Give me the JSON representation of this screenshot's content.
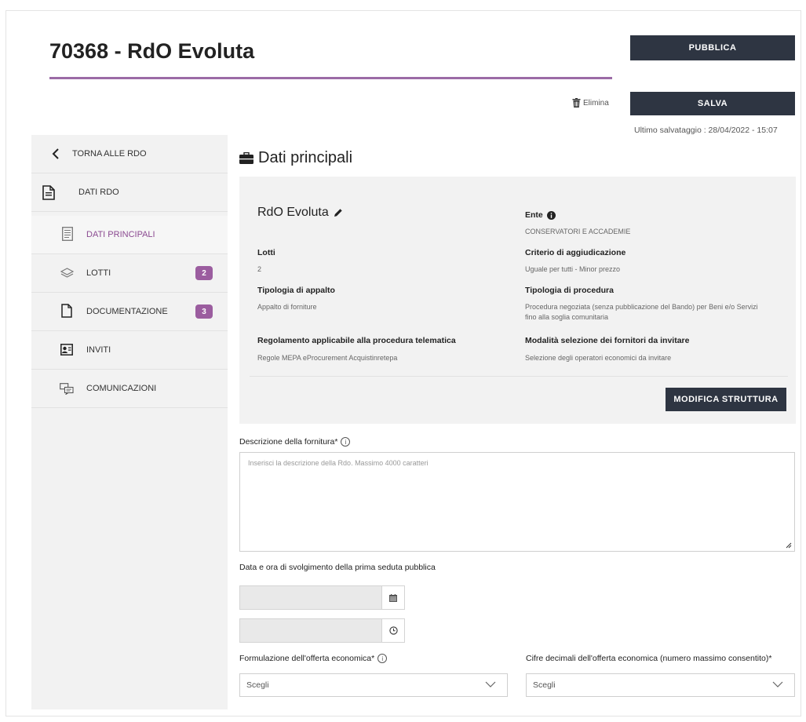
{
  "header": {
    "title": "70368 - RdO Evoluta",
    "publish_label": "PUBBLICA",
    "save_label": "SALVA",
    "delete_label": "Elimina",
    "last_save": "Ultimo salvataggio : 28/04/2022 - 15:07"
  },
  "sidebar": {
    "back_label": "TORNA ALLE RDO",
    "group_label": "DATI RDO",
    "items": [
      {
        "label": "DATI PRINCIPALI",
        "icon": "document-list-icon",
        "active": true
      },
      {
        "label": "LOTTI",
        "icon": "layers-icon",
        "badge": "2"
      },
      {
        "label": "DOCUMENTAZIONE",
        "icon": "file-icon",
        "badge": "3"
      },
      {
        "label": "INVITI",
        "icon": "contact-card-icon"
      },
      {
        "label": "COMUNICAZIONI",
        "icon": "chat-icon"
      }
    ]
  },
  "main": {
    "section_title": "Dati principali",
    "rdo_name": "RdO Evoluta",
    "fields": {
      "ente_label": "Ente",
      "ente_value": "CONSERVATORI E ACCADEMIE",
      "lotti_label": "Lotti",
      "lotti_value": "2",
      "criterio_label": "Criterio di aggiudicazione",
      "criterio_value": "Uguale per tutti - Minor prezzo",
      "tipologia_appalto_label": "Tipologia di appalto",
      "tipologia_appalto_value": "Appalto di forniture",
      "tipologia_procedura_label": "Tipologia di procedura",
      "tipologia_procedura_value_1": "Procedura negoziata (senza pubblicazione del Bando) per Beni e/o Servizi",
      "tipologia_procedura_value_2": "fino alla soglia comunitaria",
      "regolamento_label": "Regolamento applicabile alla procedura telematica",
      "regolamento_value": "Regole MEPA eProcurement Acquistinretepa",
      "modalita_label": "Modalità selezione dei fornitori da invitare",
      "modalita_value": "Selezione degli operatori economici da invitare"
    },
    "modify_label": "MODIFICA STRUTTURA",
    "descrizione_label": "Descrizione della fornitura*",
    "descrizione_placeholder": "Inserisci la descrizione della Rdo. Massimo 4000 caratteri",
    "data_ora_label": "Data e ora di svolgimento della prima seduta pubblica",
    "date_value": "",
    "time_value": "",
    "formulazione_label": "Formulazione dell'offerta economica*",
    "formulazione_value": "Scegli",
    "cifre_label": "Cifre decimali dell'offerta economica (numero massimo consentito)*",
    "cifre_value": "Scegli"
  },
  "colors": {
    "accent": "#9b6ba6",
    "dark_button": "#2e3542",
    "badge": "#9b5d9f",
    "active_text": "#8b4a91"
  }
}
